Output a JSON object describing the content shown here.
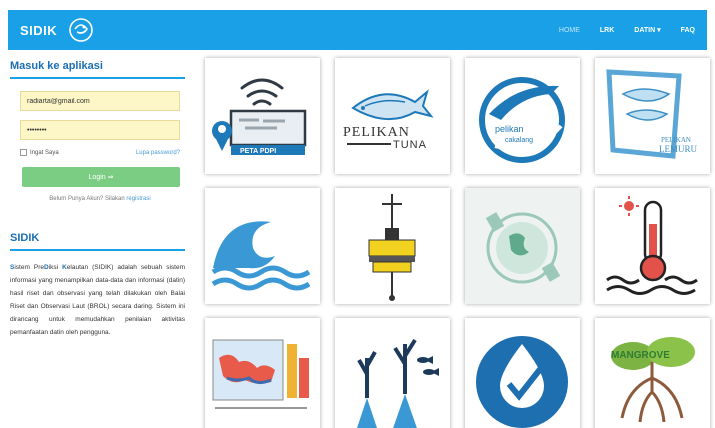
{
  "navbar": {
    "brand": "SIDIK",
    "links": [
      {
        "label": "HOME",
        "active": true
      },
      {
        "label": "LRK",
        "active": false
      },
      {
        "label": "DATIN ▾",
        "active": false
      },
      {
        "label": "FAQ",
        "active": false
      }
    ]
  },
  "login": {
    "title": "Masuk ke aplikasi",
    "email_value": "radiarta@gmail.com",
    "password_value": "••••••••",
    "remember_label": "Ingat Saya",
    "forgot_label": "Lupa password?",
    "button_label": "Login ⇒",
    "register_prompt": "Belum Punya Akun? Silakan",
    "register_link": "registrasi"
  },
  "about": {
    "title": "SIDIK",
    "text_parts": [
      "S",
      "istem Pre",
      "D",
      "iksi ",
      "K",
      "elautan (SIDIK) adalah sebuah sistem informasi yang menampilkan data-data dan informasi (datin) hasil riset dan observasi yang telah dilakukan oleh Balai Riset dan Observasi Laut (BROL) secara daring. Sistem ini dirancang untuk memudahkan penilaian aktivitas pemanfaatan datin oleh pengguna."
    ]
  },
  "tiles": [
    {
      "name": "peta-pdpi-tile",
      "caption": "PETA PDPI"
    },
    {
      "name": "pelikan-tuna-tile",
      "caption": "PELIKAN",
      "caption2": "TUNA"
    },
    {
      "name": "pelikan-cakalang-tile",
      "caption": "pelikan",
      "caption2": "cakalang"
    },
    {
      "name": "pelikan-lemuru-tile",
      "caption": "PELIKAN",
      "caption2": "LEMURU"
    },
    {
      "name": "wave-tile",
      "caption": ""
    },
    {
      "name": "buoy-tile",
      "caption": ""
    },
    {
      "name": "globe-tile",
      "caption": ""
    },
    {
      "name": "sea-temperature-tile",
      "caption": ""
    },
    {
      "name": "map-chart-tile",
      "caption": ""
    },
    {
      "name": "coral-tile",
      "caption": ""
    },
    {
      "name": "water-quality-tile",
      "caption": ""
    },
    {
      "name": "mangrove-tile",
      "caption": "MANGROVE"
    }
  ],
  "colors": {
    "navbar": "#1aa0e6",
    "accent": "#1b6fb5",
    "login_button": "#7ccd84",
    "field_bg": "#fdf6c6"
  }
}
